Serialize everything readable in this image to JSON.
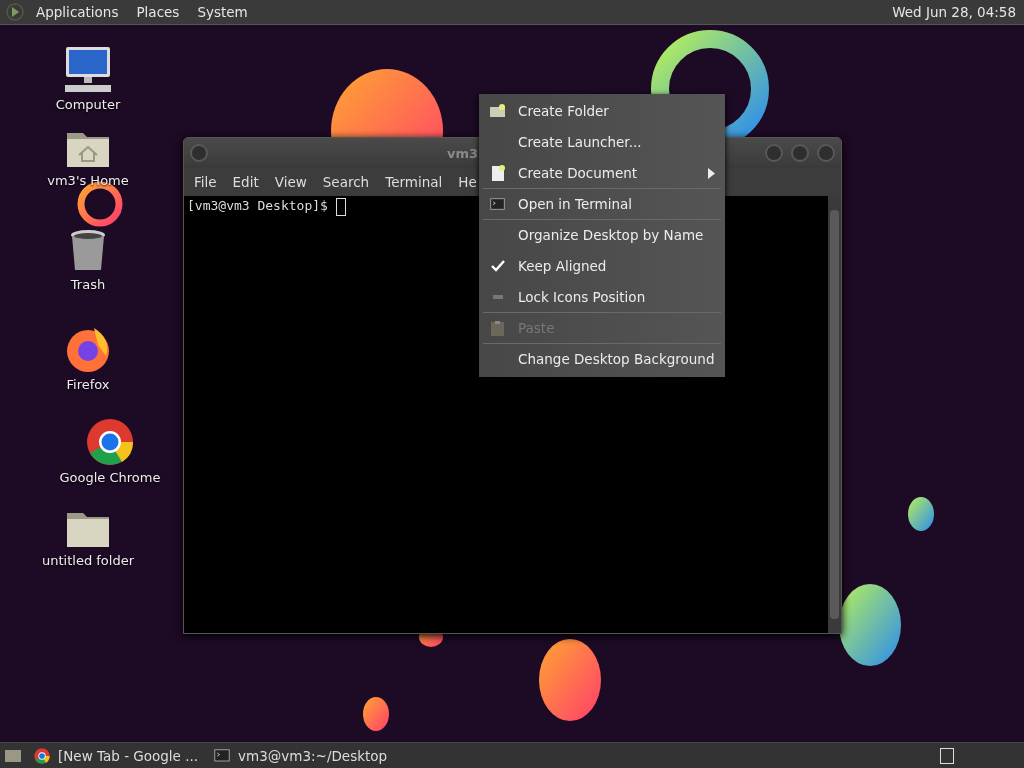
{
  "top_panel": {
    "menus": [
      "Applications",
      "Places",
      "System"
    ],
    "clock": "Wed Jun 28, 04:58"
  },
  "desktop_icons": [
    {
      "label": "Computer",
      "kind": "computer"
    },
    {
      "label": "vm3's Home",
      "kind": "home"
    },
    {
      "label": "Trash",
      "kind": "trash"
    },
    {
      "label": "Firefox",
      "kind": "firefox"
    },
    {
      "label": "Google Chrome",
      "kind": "chrome"
    },
    {
      "label": "untitled folder",
      "kind": "folder"
    }
  ],
  "terminal": {
    "title": "vm3",
    "menus": [
      "File",
      "Edit",
      "View",
      "Search",
      "Terminal",
      "He"
    ],
    "prompt": "[vm3@vm3 Desktop]$"
  },
  "context_menu": [
    {
      "label": "Create Folder",
      "kind": "folder",
      "disabled": false,
      "submenu": false,
      "separator_after": false
    },
    {
      "label": "Create Launcher...",
      "kind": "plain",
      "disabled": false,
      "submenu": false,
      "separator_after": false
    },
    {
      "label": "Create Document",
      "kind": "document",
      "disabled": false,
      "submenu": true,
      "separator_after": true
    },
    {
      "label": "Open in Terminal",
      "kind": "terminal",
      "disabled": false,
      "submenu": false,
      "separator_after": true
    },
    {
      "label": "Organize Desktop by Name",
      "kind": "plain",
      "disabled": false,
      "submenu": false,
      "separator_after": false
    },
    {
      "label": "Keep Aligned",
      "kind": "check",
      "checked": true,
      "disabled": false,
      "submenu": false,
      "separator_after": false
    },
    {
      "label": "Lock Icons Position",
      "kind": "check",
      "checked": false,
      "disabled": false,
      "submenu": false,
      "separator_after": true
    },
    {
      "label": "Paste",
      "kind": "paste",
      "disabled": true,
      "submenu": false,
      "separator_after": true
    },
    {
      "label": "Change Desktop Background",
      "kind": "plain",
      "disabled": false,
      "submenu": false,
      "separator_after": false
    }
  ],
  "taskbar": {
    "tasks": [
      {
        "label": "[New Tab - Google ...",
        "kind": "chrome"
      },
      {
        "label": "vm3@vm3:~/Desktop",
        "kind": "terminal"
      }
    ]
  }
}
